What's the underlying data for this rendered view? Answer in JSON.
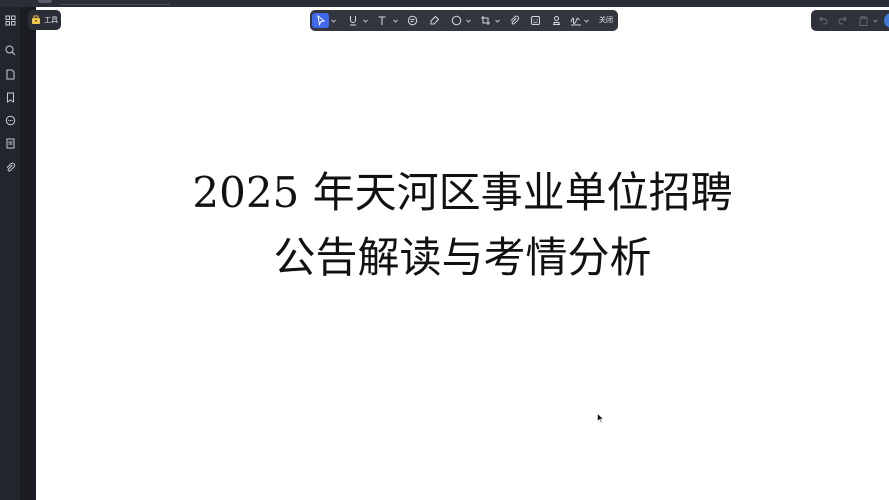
{
  "sidebar": {
    "icons": [
      "grid-icon",
      "search-icon",
      "page-icon",
      "bookmark-icon",
      "comments-icon",
      "document-icon",
      "attachment-icon"
    ]
  },
  "tools_button": {
    "label": "工具"
  },
  "annotation_toolbar": {
    "icons": [
      "select-arrow-icon",
      "underline-icon",
      "text-icon",
      "comment-icon",
      "highlighter-icon",
      "shape-circle-icon",
      "crop-icon",
      "attachment-icon",
      "stamp-icon",
      "stamp-person-icon",
      "signature-icon"
    ],
    "close_label": "关闭"
  },
  "history_toolbar": {
    "icons": [
      "undo-icon",
      "redo-icon",
      "clipboard-icon",
      "avatar"
    ]
  },
  "document": {
    "title_line1": "2025 年天河区事业单位招聘",
    "title_line2": "公告解读与考情分析"
  },
  "colors": {
    "toolbar_bg": "#33363f",
    "sidebar_bg": "#22252c",
    "accent": "#3e69f0",
    "text": "#111111"
  }
}
